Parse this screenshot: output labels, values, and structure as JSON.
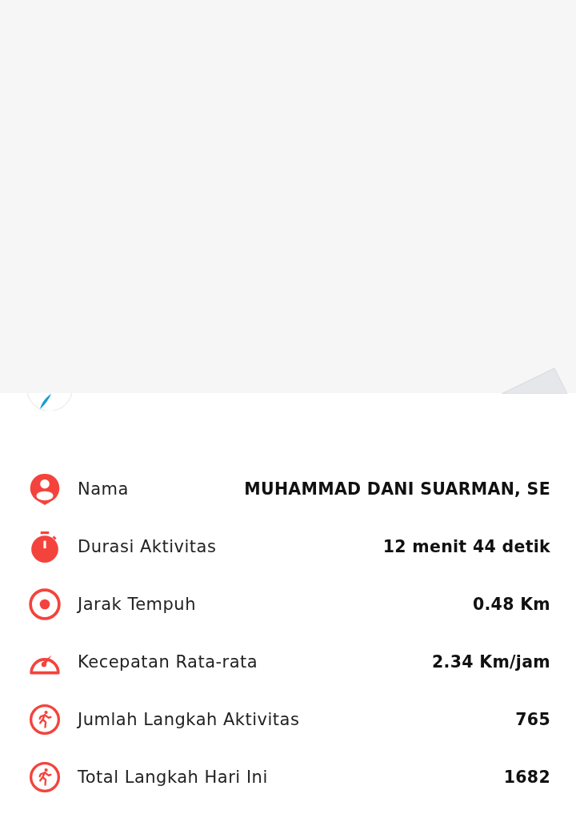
{
  "rows": [
    {
      "kind": "person",
      "label": "Nama",
      "value": "MUHAMMAD DANI SUARMAN, SE"
    },
    {
      "kind": "stopwatch",
      "label": "Durasi Aktivitas",
      "value": "12 menit 44 detik"
    },
    {
      "kind": "target",
      "label": "Jarak Tempuh",
      "value": "0.48 Km"
    },
    {
      "kind": "speedometer",
      "label": "Kecepatan Rata-rata",
      "value": "2.34 Km/jam"
    },
    {
      "kind": "runner",
      "label": "Jumlah Langkah Aktivitas",
      "value": "765"
    },
    {
      "kind": "runner",
      "label": "Total Langkah Hari Ini",
      "value": "1682"
    }
  ]
}
